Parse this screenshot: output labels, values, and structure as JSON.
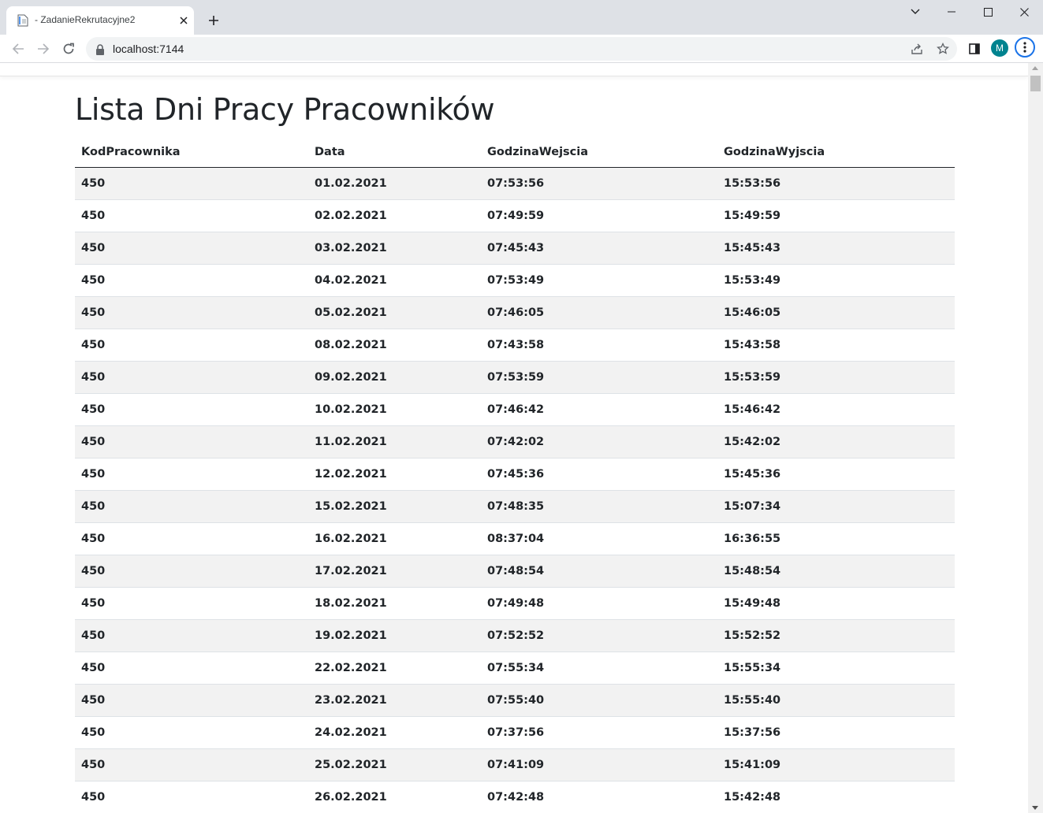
{
  "browser": {
    "tab_title": "- ZadanieRekrutacyjne2",
    "url": "localhost:7144",
    "profile_initial": "M"
  },
  "page": {
    "title": "Lista Dni Pracy Pracowników",
    "columns": [
      "KodPracownika",
      "Data",
      "GodzinaWejscia",
      "GodzinaWyjscia"
    ],
    "rows": [
      [
        "450",
        "01.02.2021",
        "07:53:56",
        "15:53:56"
      ],
      [
        "450",
        "02.02.2021",
        "07:49:59",
        "15:49:59"
      ],
      [
        "450",
        "03.02.2021",
        "07:45:43",
        "15:45:43"
      ],
      [
        "450",
        "04.02.2021",
        "07:53:49",
        "15:53:49"
      ],
      [
        "450",
        "05.02.2021",
        "07:46:05",
        "15:46:05"
      ],
      [
        "450",
        "08.02.2021",
        "07:43:58",
        "15:43:58"
      ],
      [
        "450",
        "09.02.2021",
        "07:53:59",
        "15:53:59"
      ],
      [
        "450",
        "10.02.2021",
        "07:46:42",
        "15:46:42"
      ],
      [
        "450",
        "11.02.2021",
        "07:42:02",
        "15:42:02"
      ],
      [
        "450",
        "12.02.2021",
        "07:45:36",
        "15:45:36"
      ],
      [
        "450",
        "15.02.2021",
        "07:48:35",
        "15:07:34"
      ],
      [
        "450",
        "16.02.2021",
        "08:37:04",
        "16:36:55"
      ],
      [
        "450",
        "17.02.2021",
        "07:48:54",
        "15:48:54"
      ],
      [
        "450",
        "18.02.2021",
        "07:49:48",
        "15:49:48"
      ],
      [
        "450",
        "19.02.2021",
        "07:52:52",
        "15:52:52"
      ],
      [
        "450",
        "22.02.2021",
        "07:55:34",
        "15:55:34"
      ],
      [
        "450",
        "23.02.2021",
        "07:55:40",
        "15:55:40"
      ],
      [
        "450",
        "24.02.2021",
        "07:37:56",
        "15:37:56"
      ],
      [
        "450",
        "25.02.2021",
        "07:41:09",
        "15:41:09"
      ],
      [
        "450",
        "26.02.2021",
        "07:42:48",
        "15:42:48"
      ]
    ]
  },
  "colors": {
    "accent_blue": "#1a73e8",
    "avatar_bg": "#00838f",
    "row_stripe": "#f2f2f2",
    "text": "#212529"
  },
  "icons": {
    "tab": "page-favicon-icon",
    "close": "close-icon",
    "new_tab": "plus-icon",
    "back": "back-arrow-icon",
    "forward": "forward-arrow-icon",
    "reload": "reload-icon",
    "lock": "lock-icon",
    "share": "share-icon",
    "bookmark": "star-icon",
    "side_panel": "side-panel-icon",
    "menu": "kebab-menu-icon"
  }
}
